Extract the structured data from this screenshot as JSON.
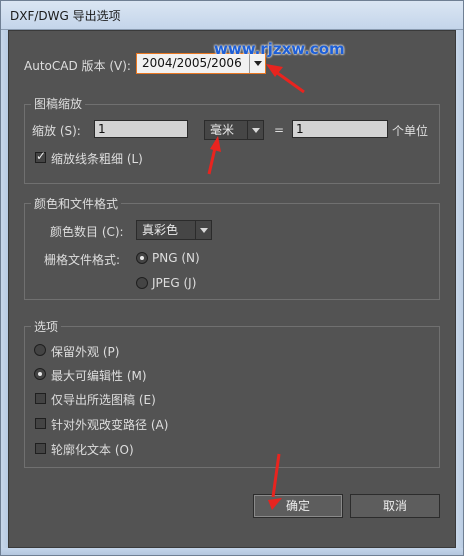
{
  "window": {
    "title": "DXF/DWG 导出选项"
  },
  "watermark": "www.rjzxw.com",
  "version": {
    "label": "AutoCAD 版本 (V):",
    "value": "2004/2005/2006"
  },
  "scale": {
    "group_title": "图稿缩放",
    "scale_label": "缩放 (S):",
    "scale_value": "1",
    "unit_value": "毫米",
    "equals": "=",
    "unit_count_value": "1",
    "unit_suffix": "个单位",
    "scale_line_weights_label": "缩放线条粗细 (L)",
    "scale_line_weights_checked": true
  },
  "color_format": {
    "group_title": "颜色和文件格式",
    "color_depth_label": "颜色数目 (C):",
    "color_depth_value": "真彩色",
    "raster_label": "栅格文件格式:",
    "raster_options": [
      "PNG (N)",
      "JPEG (J)"
    ],
    "raster_selected": "PNG (N)"
  },
  "options": {
    "group_title": "选项",
    "preserve_appearance": "保留外观 (P)",
    "max_editability": "最大可编辑性 (M)",
    "max_editability_selected": true,
    "export_selected_only": "仅导出所选图稿 (E)",
    "alter_paths": "针对外观改变路径 (A)",
    "outline_text": "轮廓化文本 (O)"
  },
  "buttons": {
    "ok": "确定",
    "cancel": "取消"
  },
  "colors": {
    "accent_arrow": "#e8241f",
    "dialog_bg": "#535353"
  }
}
